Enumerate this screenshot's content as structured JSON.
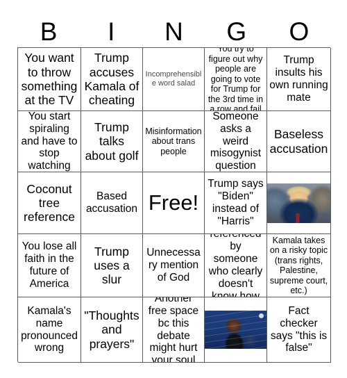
{
  "card": {
    "header": {
      "letters": [
        "B",
        "I",
        "N",
        "G",
        "O"
      ]
    },
    "rows": [
      [
        {
          "text": "You want to throw something at the TV",
          "size": "lg",
          "kind": "text"
        },
        {
          "text": "Trump accuses Kamala of cheating",
          "size": "lg",
          "kind": "text"
        },
        {
          "text": "Incomprehensible word salad",
          "size": "xs",
          "kind": "text",
          "muted": true
        },
        {
          "text": "You try to figure out why people are going to vote for Trump for the 3rd time in a row and fail",
          "size": "sm",
          "kind": "text"
        },
        {
          "text": "Trump insults his own running mate",
          "size": "md",
          "kind": "text"
        }
      ],
      [
        {
          "text": "You start spiraling and have to stop watching",
          "size": "md",
          "kind": "text"
        },
        {
          "text": "Trump talks about golf",
          "size": "lg",
          "kind": "text"
        },
        {
          "text": "Misinformation about trans people",
          "size": "sm",
          "kind": "text"
        },
        {
          "text": "Someone asks a weird misogynist question",
          "size": "md",
          "kind": "text"
        },
        {
          "text": "Baseless accusation",
          "size": "lg",
          "kind": "text"
        }
      ],
      [
        {
          "text": "Coconut tree reference",
          "size": "lg",
          "kind": "text"
        },
        {
          "text": "Based accusation",
          "size": "md",
          "kind": "text"
        },
        {
          "text": "Free!",
          "size": "free",
          "kind": "text"
        },
        {
          "text": "Trump says \"Biden\" instead of \"Harris\"",
          "size": "md",
          "kind": "text"
        },
        {
          "text": "",
          "size": "md",
          "kind": "image",
          "image": "trump-courtroom-photo",
          "alt": "Photo of Donald Trump seated in a courtroom"
        }
      ],
      [
        {
          "text": "You lose all faith in the future of America",
          "size": "md",
          "kind": "text"
        },
        {
          "text": "Trump uses a slur",
          "size": "lg",
          "kind": "text"
        },
        {
          "text": "Unnecessary mention of God",
          "size": "md",
          "kind": "text"
        },
        {
          "text": "AI referenced by someone who clearly doesn't know how AI works",
          "size": "md",
          "kind": "text"
        },
        {
          "text": "Kamala takes on a risky topic (trans rights, Palestine, supreme court, etc.)",
          "size": "sm",
          "kind": "text"
        }
      ],
      [
        {
          "text": "Kamala's name pronounced wrong",
          "size": "md",
          "kind": "text"
        },
        {
          "text": "\"Thoughts and prayers\"",
          "size": "lg",
          "kind": "text"
        },
        {
          "text": "Another free space bc this debate might hurt your soul",
          "size": "md",
          "kind": "text"
        },
        {
          "text": "",
          "size": "md",
          "kind": "image",
          "image": "kamala-debate-photo",
          "alt": "Photo of Kamala Harris at a debate podium with blue backdrop"
        },
        {
          "text": "Fact checker says \"this is false\"",
          "size": "md",
          "kind": "text"
        }
      ]
    ]
  },
  "colors": {
    "background": "#ffffff",
    "text": "#000000",
    "muted_text": "#4a4a4a",
    "grid_line": "#5a5a5a"
  }
}
